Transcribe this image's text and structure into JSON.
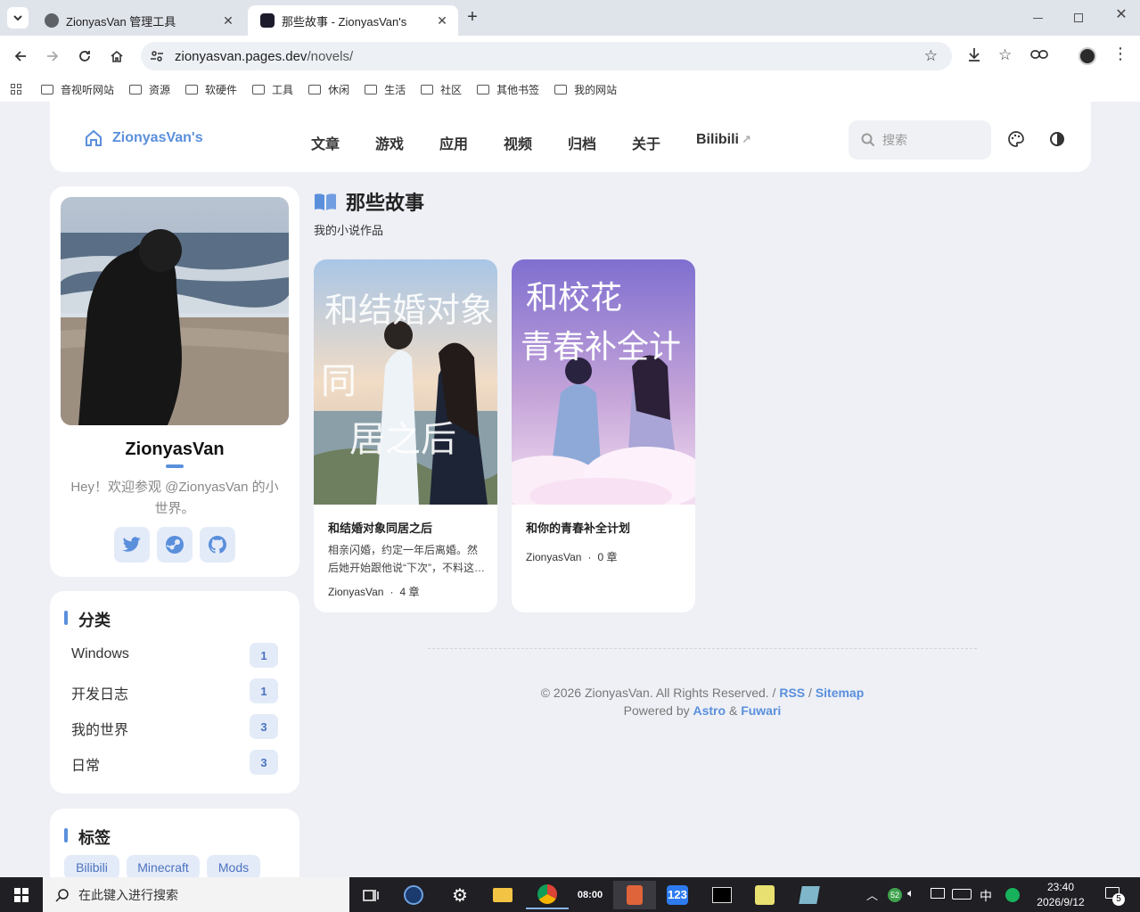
{
  "browser": {
    "tabs": [
      {
        "title": "ZionyasVan 管理工具",
        "active": false
      },
      {
        "title": "那些故事 - ZionyasVan's",
        "active": true
      }
    ],
    "new_tab_label": "+",
    "url_host": "zionyasvan.pages.dev",
    "url_path": "/novels/",
    "bookmarks": [
      "音视听网站",
      "资源",
      "软硬件",
      "工具",
      "休闲",
      "生活",
      "社区",
      "其他书签",
      "我的网站"
    ]
  },
  "site": {
    "brand": "ZionyasVan's",
    "nav": [
      "文章",
      "游戏",
      "应用",
      "视频",
      "归档",
      "关于",
      "Bilibili"
    ],
    "search_placeholder": "搜索"
  },
  "profile": {
    "name": "ZionyasVan",
    "bio": "Hey！欢迎参观 @ZionyasVan 的小世界。",
    "socials": [
      "twitter-icon",
      "steam-icon",
      "github-icon"
    ]
  },
  "categories": {
    "title": "分类",
    "items": [
      {
        "name": "Windows",
        "count": "1"
      },
      {
        "name": "开发日志",
        "count": "1"
      },
      {
        "name": "我的世界",
        "count": "3"
      },
      {
        "name": "日常",
        "count": "3"
      }
    ]
  },
  "tags": {
    "title": "标签",
    "items": [
      "Bilibili",
      "Minecraft",
      "Mods"
    ]
  },
  "main": {
    "title": "那些故事",
    "subtitle": "我的小说作品",
    "novels": [
      {
        "title": "和结婚对象同居之后",
        "desc": "相亲闪婚，约定一年后离婚。然后她开始跟他说“下次”，不料这…",
        "author": "ZionyasVan",
        "chapters": "4 章"
      },
      {
        "title": "和你的青春补全计划",
        "desc": "",
        "author": "ZionyasVan",
        "chapters": "0 章"
      }
    ]
  },
  "footer": {
    "copyright": "© 2026 ZionyasVan. All Rights Reserved. /",
    "rss": "RSS",
    "sep": "/",
    "sitemap": "Sitemap",
    "powered": "Powered by",
    "astro": "Astro",
    "amp": "&",
    "fuwari": "Fuwari"
  },
  "taskbar": {
    "search_placeholder": "在此键入进行搜索",
    "clock_time": "23:40",
    "clock_date": "2026/9/12",
    "ime": "中",
    "notif_count": "5",
    "tray_badge": "52"
  },
  "colors": {
    "accent": "#5a8fdc",
    "page_bg": "#eef0f6",
    "taskbar": "#1f1f24"
  }
}
